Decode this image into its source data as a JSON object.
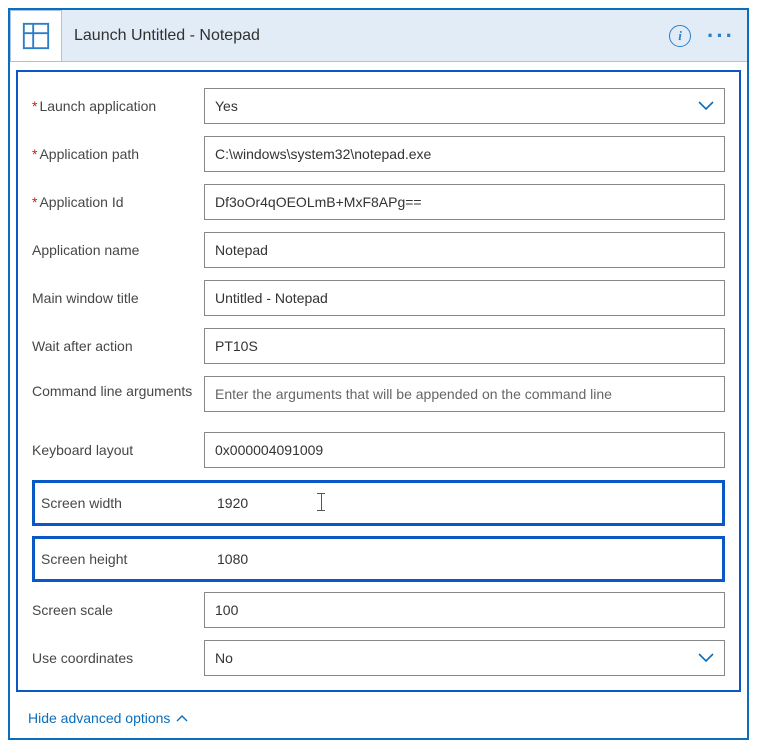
{
  "header": {
    "title": "Launch Untitled - Notepad"
  },
  "fields": {
    "launch_app": {
      "label": "Launch application",
      "value": "Yes",
      "required": true
    },
    "app_path": {
      "label": "Application path",
      "value": "C:\\windows\\system32\\notepad.exe",
      "required": true
    },
    "app_id": {
      "label": "Application Id",
      "value": "Df3oOr4qOEOLmB+MxF8APg==",
      "required": true
    },
    "app_name": {
      "label": "Application name",
      "value": "Notepad"
    },
    "main_window_title": {
      "label": "Main window title",
      "value": "Untitled - Notepad"
    },
    "wait_after": {
      "label": "Wait after action",
      "value": "PT10S"
    },
    "cmd_args": {
      "label": "Command line arguments",
      "placeholder": "Enter the arguments that will be appended on the command line"
    },
    "keyboard_layout": {
      "label": "Keyboard layout",
      "value": "0x000004091009"
    },
    "screen_width": {
      "label": "Screen width",
      "value": "1920"
    },
    "screen_height": {
      "label": "Screen height",
      "value": "1080"
    },
    "screen_scale": {
      "label": "Screen scale",
      "value": "100"
    },
    "use_coordinates": {
      "label": "Use coordinates",
      "value": "No"
    }
  },
  "footer": {
    "hide_link": "Hide advanced options"
  }
}
